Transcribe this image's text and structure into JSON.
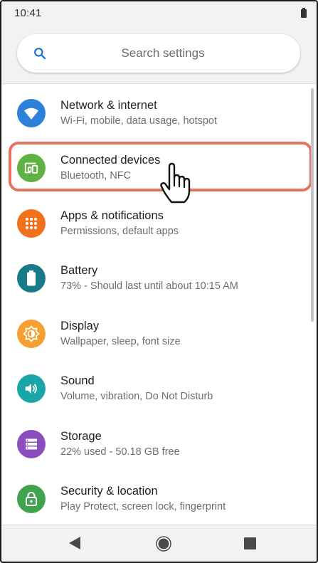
{
  "status_bar": {
    "time": "10:41"
  },
  "search": {
    "placeholder": "Search settings"
  },
  "settings": [
    {
      "title": "Network & internet",
      "subtitle": "Wi-Fi, mobile, data usage, hotspot",
      "icon": "wifi-icon",
      "color": "#2f80d8"
    },
    {
      "title": "Connected devices",
      "subtitle": "Bluetooth, NFC",
      "icon": "devices-icon",
      "color": "#5fb144"
    },
    {
      "title": "Apps & notifications",
      "subtitle": "Permissions, default apps",
      "icon": "apps-icon",
      "color": "#f2711c"
    },
    {
      "title": "Battery",
      "subtitle": "73% - Should last until about 10:15 AM",
      "icon": "battery-icon",
      "color": "#1b7a8a"
    },
    {
      "title": "Display",
      "subtitle": "Wallpaper, sleep, font size",
      "icon": "brightness-icon",
      "color": "#f5a033"
    },
    {
      "title": "Sound",
      "subtitle": "Volume, vibration, Do Not Disturb",
      "icon": "volume-icon",
      "color": "#1aa6a6"
    },
    {
      "title": "Storage",
      "subtitle": "22% used - 50.18 GB free",
      "icon": "storage-icon",
      "color": "#8a4fbf"
    },
    {
      "title": "Security & location",
      "subtitle": "Play Protect, screen lock, fingerprint",
      "icon": "lock-icon",
      "color": "#3fa34d"
    }
  ],
  "highlight_color": "#e5735f"
}
